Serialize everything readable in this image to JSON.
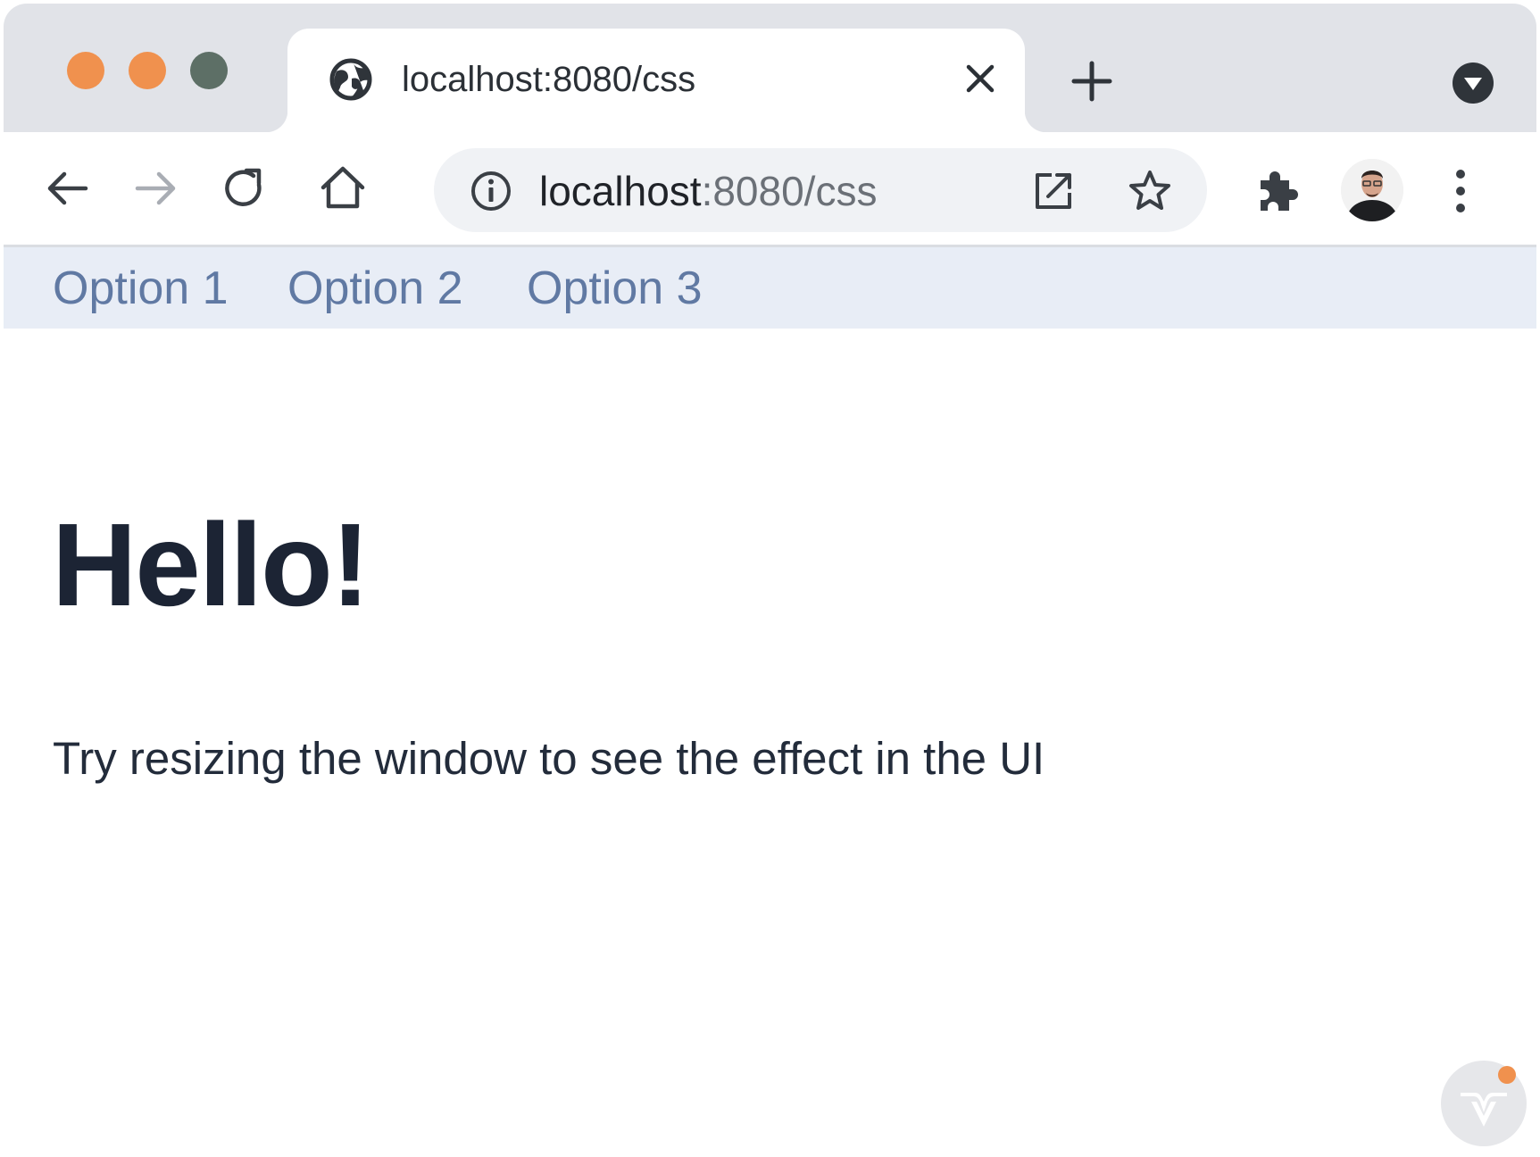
{
  "browser": {
    "tab": {
      "title": "localhost:8080/css",
      "favicon": "globe-icon"
    },
    "omnibox": {
      "host": "localhost",
      "rest": ":8080/css"
    },
    "icons": {
      "back": "arrow-left-icon",
      "forward": "arrow-right-icon",
      "reload": "reload-icon",
      "home": "home-icon",
      "info": "info-icon",
      "open_external": "open-external-icon",
      "bookmark": "star-icon",
      "extensions": "puzzle-icon",
      "profile": "avatar",
      "menu": "kebab-icon",
      "new_tab": "plus-icon",
      "tab_search": "chevron-down-icon"
    },
    "colors": {
      "traffic_close": "#f0914e",
      "traffic_minimize": "#f0914e",
      "traffic_maximize": "#5d6f66"
    }
  },
  "page": {
    "nav": [
      {
        "label": "Option 1"
      },
      {
        "label": "Option 2"
      },
      {
        "label": "Option 3"
      }
    ],
    "heading": "Hello!",
    "body_text": "Try resizing the window to see the effect in the UI",
    "colors": {
      "nav_background": "#e8edf6",
      "nav_text": "#6079a3",
      "heading": "#1c2434",
      "badge_dot": "#f0914e"
    }
  }
}
